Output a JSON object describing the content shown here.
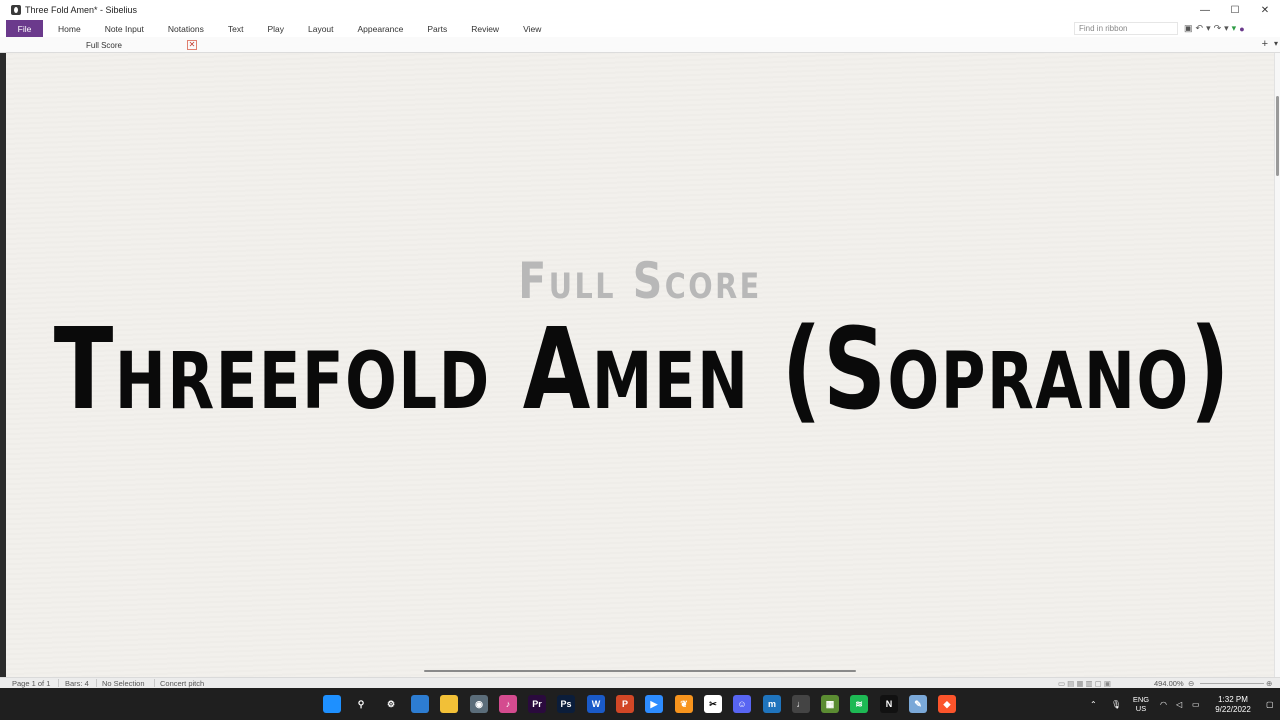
{
  "window": {
    "title": "Three Fold Amen* - Sibelius",
    "minimize": "—",
    "maximize": "☐",
    "close": "✕"
  },
  "ribbon": {
    "tabs": [
      {
        "label": "File"
      },
      {
        "label": "Home"
      },
      {
        "label": "Note Input"
      },
      {
        "label": "Notations"
      },
      {
        "label": "Text"
      },
      {
        "label": "Play"
      },
      {
        "label": "Layout"
      },
      {
        "label": "Appearance"
      },
      {
        "label": "Parts"
      },
      {
        "label": "Review"
      },
      {
        "label": "View"
      }
    ],
    "find_placeholder": "Find in ribbon"
  },
  "document_tab": {
    "label": "Full Score",
    "close": "✕"
  },
  "score": {
    "subtitle": "Full Score",
    "title": "Threefold Amen (Soprano)"
  },
  "status": {
    "page": "Page 1 of 1",
    "bars": "Bars: 4",
    "selection": "No Selection",
    "pitch": "Concert pitch",
    "zoom": "494.00%"
  },
  "taskbar": {
    "lang_top": "ENG",
    "lang_bottom": "US",
    "time": "1:32 PM",
    "date": "9/22/2022",
    "icons": [
      {
        "name": "windows-start-icon",
        "glyph": "",
        "color": "#1e90ff"
      },
      {
        "name": "search-icon",
        "glyph": "⚲",
        "color": "transparent"
      },
      {
        "name": "settings-icon",
        "glyph": "⚙",
        "color": "transparent"
      },
      {
        "name": "store-icon",
        "glyph": "",
        "color": "#2d7dd2"
      },
      {
        "name": "file-explorer-icon",
        "glyph": "",
        "color": "#f2c037"
      },
      {
        "name": "camera-icon",
        "glyph": "◉",
        "color": "#5b6d7a"
      },
      {
        "name": "itunes-icon",
        "glyph": "♪",
        "color": "#d44b8f"
      },
      {
        "name": "premiere-icon",
        "glyph": "Pr",
        "color": "#2a0a3d"
      },
      {
        "name": "photoshop-icon",
        "glyph": "Ps",
        "color": "#0b1d3a"
      },
      {
        "name": "word-icon",
        "glyph": "W",
        "color": "#1a5ac8"
      },
      {
        "name": "powerpoint-icon",
        "glyph": "P",
        "color": "#d24726"
      },
      {
        "name": "zoom-icon",
        "glyph": "▶",
        "color": "#2d8cff"
      },
      {
        "name": "fl-studio-icon",
        "glyph": "❦",
        "color": "#f7941d"
      },
      {
        "name": "capcut-icon",
        "glyph": "✂",
        "color": "#ffffff"
      },
      {
        "name": "discord-icon",
        "glyph": "☺",
        "color": "#5865f2"
      },
      {
        "name": "musescore-icon",
        "glyph": "m",
        "color": "#1f74bd"
      },
      {
        "name": "sibelius-icon",
        "glyph": "♩",
        "color": "#444444"
      },
      {
        "name": "minecraft-icon",
        "glyph": "▦",
        "color": "#5b8c32"
      },
      {
        "name": "spotify-icon",
        "glyph": "≋",
        "color": "#1db954"
      },
      {
        "name": "netflix-icon",
        "glyph": "N",
        "color": "#111111"
      },
      {
        "name": "notepad-icon",
        "glyph": "✎",
        "color": "#7aa8d8"
      },
      {
        "name": "brave-icon",
        "glyph": "◆",
        "color": "#fb542b"
      }
    ]
  }
}
